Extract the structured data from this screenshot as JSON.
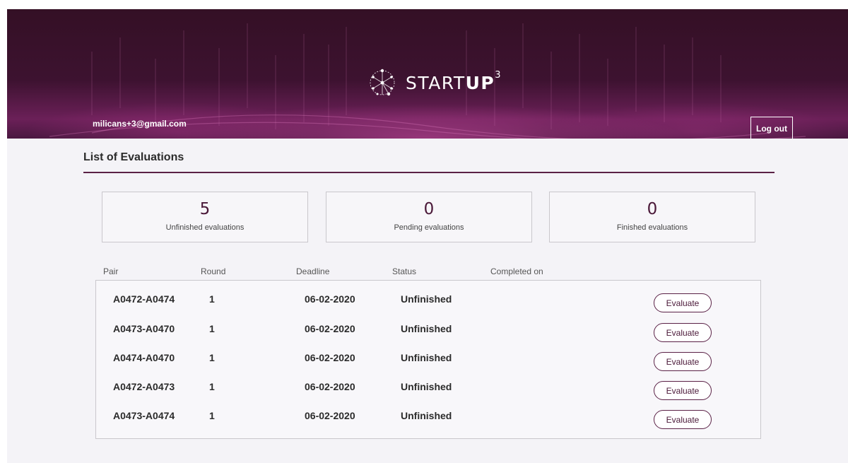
{
  "header": {
    "logo_text_light": "START",
    "logo_text_bold": "UP",
    "logo_superscript": "3",
    "user_email": "milicans+3@gmail.com",
    "logout_label": "Log out"
  },
  "page": {
    "title": "List of Evaluations"
  },
  "stats": [
    {
      "value": "5",
      "label": "Unfinished evaluations"
    },
    {
      "value": "0",
      "label": "Pending evaluations"
    },
    {
      "value": "0",
      "label": "Finished evaluations"
    }
  ],
  "table": {
    "columns": [
      "Pair",
      "Round",
      "Deadline",
      "Status",
      "Completed on"
    ],
    "rows": [
      {
        "pair": "A0472-A0474",
        "round": "1",
        "deadline": "06-02-2020",
        "status": "Unfinished",
        "completed_on": "",
        "action": "Evaluate"
      },
      {
        "pair": "A0473-A0470",
        "round": "1",
        "deadline": "06-02-2020",
        "status": "Unfinished",
        "completed_on": "",
        "action": "Evaluate"
      },
      {
        "pair": "A0474-A0470",
        "round": "1",
        "deadline": "06-02-2020",
        "status": "Unfinished",
        "completed_on": "",
        "action": "Evaluate"
      },
      {
        "pair": "A0472-A0473",
        "round": "1",
        "deadline": "06-02-2020",
        "status": "Unfinished",
        "completed_on": "",
        "action": "Evaluate"
      },
      {
        "pair": "A0473-A0474",
        "round": "1",
        "deadline": "06-02-2020",
        "status": "Unfinished",
        "completed_on": "",
        "action": "Evaluate"
      }
    ]
  },
  "colors": {
    "brand_dark": "#3d1230",
    "brand_accent": "#5a2146",
    "glow": "#d650aa",
    "background": "#f4f3f7"
  },
  "icons": {
    "logo_mark": "network-brain-icon"
  }
}
